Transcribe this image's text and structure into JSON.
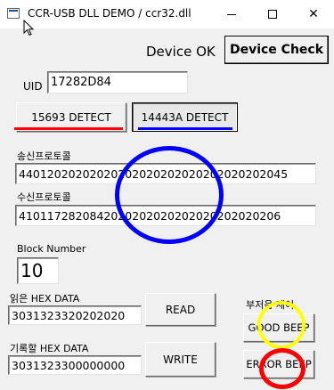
{
  "window": {
    "title": "CCR-USB DLL DEMO / ccr32.dll"
  },
  "status": {
    "text": "Device OK"
  },
  "buttons": {
    "device_check": "Device Check",
    "detect_15693": "15693  DETECT",
    "detect_14443a": "14443A  DETECT",
    "read": "READ",
    "write": "WRITE",
    "good_beep": "GOOD BEEP",
    "error_beep": "ERROR BEEP"
  },
  "fields": {
    "uid_label": "UID",
    "uid_value": "17282D84",
    "send_protocol_label": "송신프로토콜",
    "send_protocol_value": "44012020202020202020202020202020202045",
    "recv_protocol_label": "수신프로토콜",
    "recv_protocol_value": "4101172820842020202020202020202020206",
    "block_number_label": "Block Number",
    "block_number_value": "10",
    "read_hex_label": "읽은 HEX DATA",
    "read_hex_value": "3031323320202020",
    "write_hex_label": "기록할 HEX DATA",
    "write_hex_value": "3031323300000000",
    "buzzer_label": "부저음 제어"
  },
  "annotations": {
    "red_underline_color": "#ff0000",
    "blue_underline_color": "#0000ff",
    "blue_circle_color": "#0000ff",
    "yellow_circle_color": "#ffff00",
    "red_circle_color": "#ff0000"
  }
}
